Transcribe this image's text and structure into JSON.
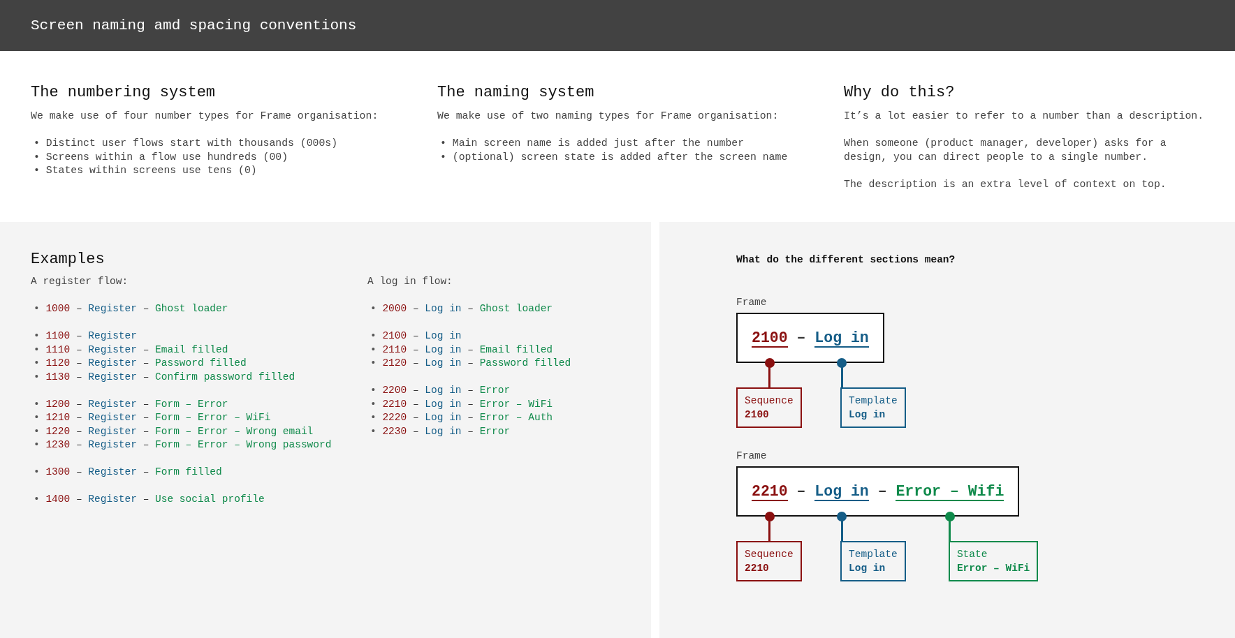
{
  "header": {
    "title": "Screen naming amd spacing conventions"
  },
  "intro_columns": [
    {
      "heading": "The numbering system",
      "paragraphs": [
        "We make use of four number types for Frame organisation:"
      ],
      "bullets": [
        "• Distinct user flows start with thousands (000s)",
        "• Screens within a flow use hundreds (00)",
        "• States within screens use tens (0)"
      ]
    },
    {
      "heading": "The naming system",
      "paragraphs": [
        "We make use of two naming types for Frame organisation:"
      ],
      "bullets": [
        "• Main screen name is added just after the number",
        "• (optional) screen state is added after the screen name"
      ]
    },
    {
      "heading": "Why do this?",
      "paragraphs": [
        "It’s a lot easier to refer to a number than a description.",
        "When someone (product manager, developer) asks for a design, you can direct people to a single number.",
        "The description is an extra level of context on top."
      ]
    }
  ],
  "examples": {
    "heading": "Examples",
    "flows": [
      {
        "title": "A register flow:",
        "groups": [
          [
            [
              {
                "kind": "bullet",
                "text": "•"
              },
              {
                "kind": "sequence",
                "text": "1000"
              },
              {
                "kind": "separator",
                "text": "–"
              },
              {
                "kind": "template",
                "text": "Register"
              },
              {
                "kind": "separator",
                "text": "–"
              },
              {
                "kind": "state",
                "text": "Ghost loader"
              }
            ]
          ],
          [
            [
              {
                "kind": "bullet",
                "text": "•"
              },
              {
                "kind": "sequence",
                "text": "1100"
              },
              {
                "kind": "separator",
                "text": "–"
              },
              {
                "kind": "template",
                "text": "Register"
              }
            ],
            [
              {
                "kind": "bullet",
                "text": "•"
              },
              {
                "kind": "sequence",
                "text": "1110"
              },
              {
                "kind": "separator",
                "text": "–"
              },
              {
                "kind": "template",
                "text": "Register"
              },
              {
                "kind": "separator",
                "text": "–"
              },
              {
                "kind": "state",
                "text": "Email filled"
              }
            ],
            [
              {
                "kind": "bullet",
                "text": "•"
              },
              {
                "kind": "sequence",
                "text": "1120"
              },
              {
                "kind": "separator",
                "text": "–"
              },
              {
                "kind": "template",
                "text": "Register"
              },
              {
                "kind": "separator",
                "text": "–"
              },
              {
                "kind": "state",
                "text": "Password filled"
              }
            ],
            [
              {
                "kind": "bullet",
                "text": "•"
              },
              {
                "kind": "sequence",
                "text": "1130"
              },
              {
                "kind": "separator",
                "text": "–"
              },
              {
                "kind": "template",
                "text": "Register"
              },
              {
                "kind": "separator",
                "text": "–"
              },
              {
                "kind": "state",
                "text": "Confirm password filled"
              }
            ]
          ],
          [
            [
              {
                "kind": "bullet",
                "text": "•"
              },
              {
                "kind": "sequence",
                "text": "1200"
              },
              {
                "kind": "separator",
                "text": "–"
              },
              {
                "kind": "template",
                "text": "Register"
              },
              {
                "kind": "separator",
                "text": "–"
              },
              {
                "kind": "state",
                "text": "Form – Error"
              }
            ],
            [
              {
                "kind": "bullet",
                "text": "•"
              },
              {
                "kind": "sequence",
                "text": "1210"
              },
              {
                "kind": "separator",
                "text": "–"
              },
              {
                "kind": "template",
                "text": "Register"
              },
              {
                "kind": "separator",
                "text": "–"
              },
              {
                "kind": "state",
                "text": "Form – Error – WiFi"
              }
            ],
            [
              {
                "kind": "bullet",
                "text": "•"
              },
              {
                "kind": "sequence",
                "text": "1220"
              },
              {
                "kind": "separator",
                "text": "–"
              },
              {
                "kind": "template",
                "text": "Register"
              },
              {
                "kind": "separator",
                "text": "–"
              },
              {
                "kind": "state",
                "text": "Form – Error – Wrong email"
              }
            ],
            [
              {
                "kind": "bullet",
                "text": "•"
              },
              {
                "kind": "sequence",
                "text": "1230"
              },
              {
                "kind": "separator",
                "text": "–"
              },
              {
                "kind": "template",
                "text": "Register"
              },
              {
                "kind": "separator",
                "text": "–"
              },
              {
                "kind": "state",
                "text": "Form – Error – Wrong password"
              }
            ]
          ],
          [
            [
              {
                "kind": "bullet",
                "text": "•"
              },
              {
                "kind": "sequence",
                "text": "1300"
              },
              {
                "kind": "separator",
                "text": "–"
              },
              {
                "kind": "template",
                "text": "Register"
              },
              {
                "kind": "separator",
                "text": "–"
              },
              {
                "kind": "state",
                "text": "Form filled"
              }
            ]
          ],
          [
            [
              {
                "kind": "bullet",
                "text": "•"
              },
              {
                "kind": "sequence",
                "text": "1400"
              },
              {
                "kind": "separator",
                "text": "–"
              },
              {
                "kind": "template",
                "text": "Register"
              },
              {
                "kind": "separator",
                "text": "–"
              },
              {
                "kind": "state",
                "text": "Use social profile"
              }
            ]
          ]
        ]
      },
      {
        "title": "A log in flow:",
        "groups": [
          [
            [
              {
                "kind": "bullet",
                "text": "•"
              },
              {
                "kind": "sequence",
                "text": "2000"
              },
              {
                "kind": "separator",
                "text": "–"
              },
              {
                "kind": "template",
                "text": "Log in"
              },
              {
                "kind": "separator",
                "text": "–"
              },
              {
                "kind": "state",
                "text": "Ghost loader"
              }
            ]
          ],
          [
            [
              {
                "kind": "bullet",
                "text": "•"
              },
              {
                "kind": "sequence",
                "text": "2100"
              },
              {
                "kind": "separator",
                "text": "–"
              },
              {
                "kind": "template",
                "text": "Log in"
              }
            ],
            [
              {
                "kind": "bullet",
                "text": "•"
              },
              {
                "kind": "sequence",
                "text": "2110"
              },
              {
                "kind": "separator",
                "text": "–"
              },
              {
                "kind": "template",
                "text": "Log in"
              },
              {
                "kind": "separator",
                "text": "–"
              },
              {
                "kind": "state",
                "text": "Email filled"
              }
            ],
            [
              {
                "kind": "bullet",
                "text": "•"
              },
              {
                "kind": "sequence",
                "text": "2120"
              },
              {
                "kind": "separator",
                "text": "–"
              },
              {
                "kind": "template",
                "text": "Log in"
              },
              {
                "kind": "separator",
                "text": "–"
              },
              {
                "kind": "state",
                "text": "Password filled"
              }
            ]
          ],
          [
            [
              {
                "kind": "bullet",
                "text": "•"
              },
              {
                "kind": "sequence",
                "text": "2200"
              },
              {
                "kind": "separator",
                "text": "–"
              },
              {
                "kind": "template",
                "text": "Log in"
              },
              {
                "kind": "separator",
                "text": "–"
              },
              {
                "kind": "state",
                "text": "Error"
              }
            ],
            [
              {
                "kind": "bullet",
                "text": "•"
              },
              {
                "kind": "sequence",
                "text": "2210"
              },
              {
                "kind": "separator",
                "text": "–"
              },
              {
                "kind": "template",
                "text": "Log in"
              },
              {
                "kind": "separator",
                "text": "–"
              },
              {
                "kind": "state",
                "text": "Error – WiFi"
              }
            ],
            [
              {
                "kind": "bullet",
                "text": "•"
              },
              {
                "kind": "sequence",
                "text": "2220"
              },
              {
                "kind": "separator",
                "text": "–"
              },
              {
                "kind": "template",
                "text": "Log in"
              },
              {
                "kind": "separator",
                "text": "–"
              },
              {
                "kind": "state",
                "text": "Error – Auth"
              }
            ],
            [
              {
                "kind": "bullet",
                "text": "•"
              },
              {
                "kind": "sequence",
                "text": "2230"
              },
              {
                "kind": "separator",
                "text": "–"
              },
              {
                "kind": "template",
                "text": "Log in"
              },
              {
                "kind": "separator",
                "text": "–"
              },
              {
                "kind": "state",
                "text": "Error"
              }
            ]
          ]
        ]
      }
    ]
  },
  "sections_diagram": {
    "title": "What do the different sections mean?",
    "frames": [
      {
        "label": "Frame",
        "segments": [
          {
            "kind": "sequence",
            "text": "2100"
          },
          {
            "kind": "separator",
            "text": "–"
          },
          {
            "kind": "template",
            "text": "Log in"
          }
        ],
        "callouts": [
          {
            "kind": "sequence",
            "title": "Sequence",
            "value": "2100"
          },
          {
            "kind": "template",
            "title": "Template",
            "value": "Log in"
          }
        ]
      },
      {
        "label": "Frame",
        "segments": [
          {
            "kind": "sequence",
            "text": "2210"
          },
          {
            "kind": "separator",
            "text": "–"
          },
          {
            "kind": "template",
            "text": "Log in"
          },
          {
            "kind": "separator",
            "text": "–"
          },
          {
            "kind": "state",
            "text": "Error – Wifi"
          }
        ],
        "callouts": [
          {
            "kind": "sequence",
            "title": "Sequence",
            "value": "2210"
          },
          {
            "kind": "template",
            "title": "Template",
            "value": "Log in"
          },
          {
            "kind": "state",
            "title": "State",
            "value": "Error – WiFi"
          }
        ]
      }
    ]
  }
}
